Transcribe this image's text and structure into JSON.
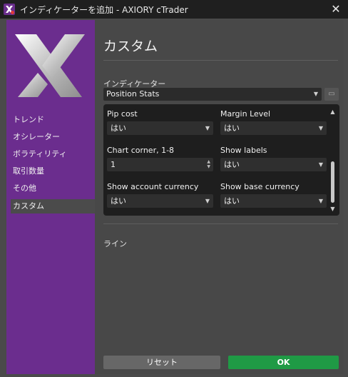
{
  "window": {
    "title": "インディケーターを追加 - AXIORY cTrader",
    "close_glyph": "✕"
  },
  "sidebar": {
    "items": [
      {
        "label": "トレンド"
      },
      {
        "label": "オシレーター"
      },
      {
        "label": "ボラティリティ"
      },
      {
        "label": "取引数量"
      },
      {
        "label": "その他"
      },
      {
        "label": "カスタム",
        "active": true
      }
    ]
  },
  "main": {
    "heading": "カスタム",
    "indicator_label": "インディケーター",
    "indicator_value": "Position Stats",
    "params": [
      {
        "label": "Pip cost",
        "value": "はい",
        "kind": "dropdown"
      },
      {
        "label": "Margin Level",
        "value": "はい",
        "kind": "dropdown"
      },
      {
        "label": "Chart corner, 1-8",
        "value": "1",
        "kind": "stepper"
      },
      {
        "label": "Show labels",
        "value": "はい",
        "kind": "dropdown"
      },
      {
        "label": "Show account currency",
        "value": "はい",
        "kind": "dropdown"
      },
      {
        "label": "Show base currency",
        "value": "はい",
        "kind": "dropdown"
      }
    ],
    "lines_label": "ライン"
  },
  "footer": {
    "reset_label": "リセット",
    "ok_label": "OK"
  },
  "colors": {
    "sidebar": "#6b2d8e",
    "ok": "#1f9a45",
    "titlebar": "#1f1f1f"
  }
}
